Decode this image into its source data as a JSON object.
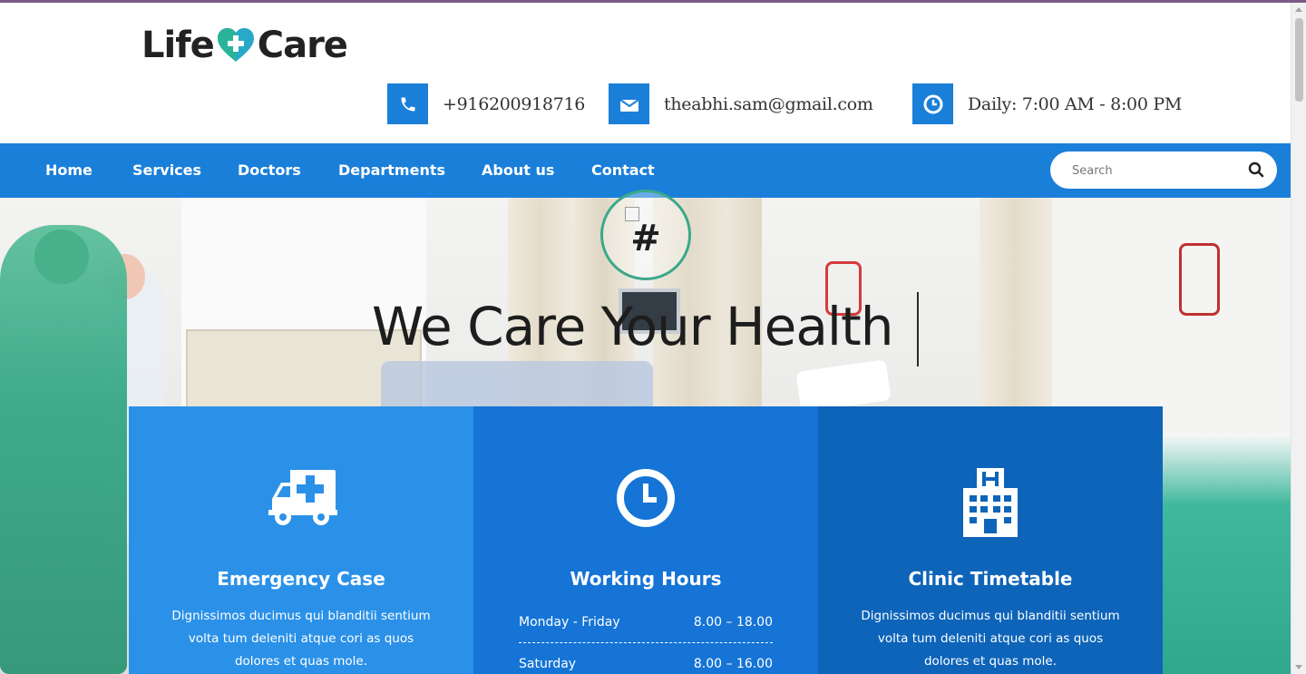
{
  "header": {
    "logo": {
      "part1": "Life",
      "part2": "Care"
    },
    "contacts": [
      {
        "icon": "phone-icon",
        "text": "+916200918716"
      },
      {
        "icon": "envelope-icon",
        "text": "theabhi.sam@gmail.com"
      },
      {
        "icon": "clock-icon",
        "text": "Daily: 7:00 AM - 8:00 PM"
      }
    ]
  },
  "nav": {
    "items": [
      "Home",
      "Services",
      "Doctors",
      "Departments",
      "About us",
      "Contact"
    ],
    "search_placeholder": "Search"
  },
  "hero": {
    "avatar_alt_text": "#",
    "title": "We Care Your Health"
  },
  "cards": [
    {
      "icon": "ambulance-icon",
      "title": "Emergency Case",
      "description": "Dignissimos ducimus qui blanditii sentium volta tum deleniti atque cori as quos dolores et quas mole."
    },
    {
      "icon": "clock-icon",
      "title": "Working Hours",
      "hours": [
        {
          "day": "Monday - Friday",
          "time": "8.00 – 18.00"
        },
        {
          "day": "Saturday",
          "time": "8.00 – 16.00"
        }
      ]
    },
    {
      "icon": "hospital-icon",
      "title": "Clinic Timetable",
      "description": "Dignissimos ducimus qui blanditii sentium volta tum deleniti atque cori as quos dolores et quas mole."
    }
  ],
  "colors": {
    "brand_blue": "#1a7fd9",
    "card1": "#2b91e8",
    "card2": "#1574d6",
    "card3": "#0d64b9",
    "accent_teal": "#3ba88b"
  }
}
